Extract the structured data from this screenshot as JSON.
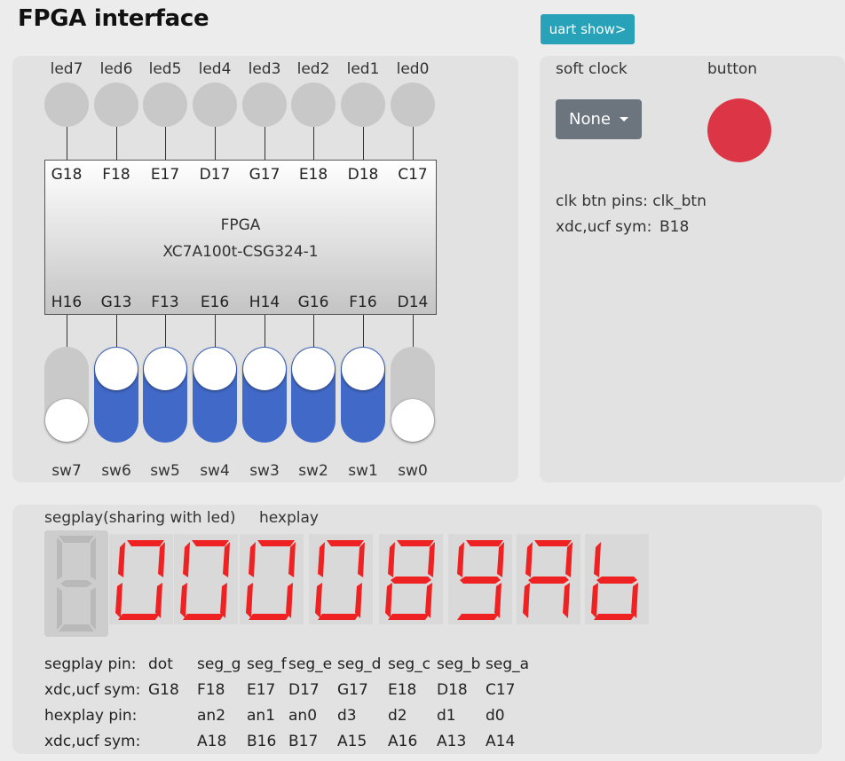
{
  "app": {
    "title": "FPGA interface",
    "uart_button": "uart show>"
  },
  "leds": {
    "labels": [
      "led7",
      "led6",
      "led5",
      "led4",
      "led3",
      "led2",
      "led1",
      "led0"
    ],
    "pins": [
      "G18",
      "F18",
      "E17",
      "D17",
      "G17",
      "E18",
      "D18",
      "C17"
    ]
  },
  "chip": {
    "name": "FPGA",
    "part": "XC7A100t-CSG324-1"
  },
  "switches": {
    "pins": [
      "H16",
      "G13",
      "F13",
      "E16",
      "H14",
      "G16",
      "F16",
      "D14"
    ],
    "labels": [
      "sw7",
      "sw6",
      "sw5",
      "sw4",
      "sw3",
      "sw2",
      "sw1",
      "sw0"
    ],
    "states": [
      false,
      true,
      true,
      true,
      true,
      true,
      true,
      false
    ]
  },
  "right_panel": {
    "soft_clock_label": "soft clock",
    "button_label": "button",
    "clock_value": "None",
    "clk_btn_pins": "clk btn pins: clk_btn",
    "xdc_label": "xdc,ucf sym:",
    "xdc_value": "B18"
  },
  "display": {
    "segplay_label": "segplay(sharing with led)",
    "hexplay_label": "hexplay",
    "digits": [
      "0",
      "0",
      "0",
      "0",
      "8",
      "9",
      "A",
      "b"
    ],
    "segment_color": "#ee2222",
    "segment_off_color": "#b9b9b9"
  },
  "pin_table": {
    "rows": [
      [
        "segplay pin:",
        "dot",
        "seg_g",
        "seg_f",
        "seg_e",
        "seg_d",
        "seg_c",
        "seg_b",
        "seg_a"
      ],
      [
        "xdc,ucf sym:",
        "G18",
        "F18",
        "E17",
        "D17",
        "G17",
        "E18",
        "D18",
        "C17"
      ],
      [
        "hexplay pin:",
        "",
        "an2",
        "an1",
        "an0",
        "d3",
        "d2",
        "d1",
        "d0"
      ],
      [
        "xdc,ucf sym:",
        "",
        "A18",
        "B16",
        "B17",
        "A15",
        "A16",
        "A13",
        "A14"
      ]
    ]
  }
}
